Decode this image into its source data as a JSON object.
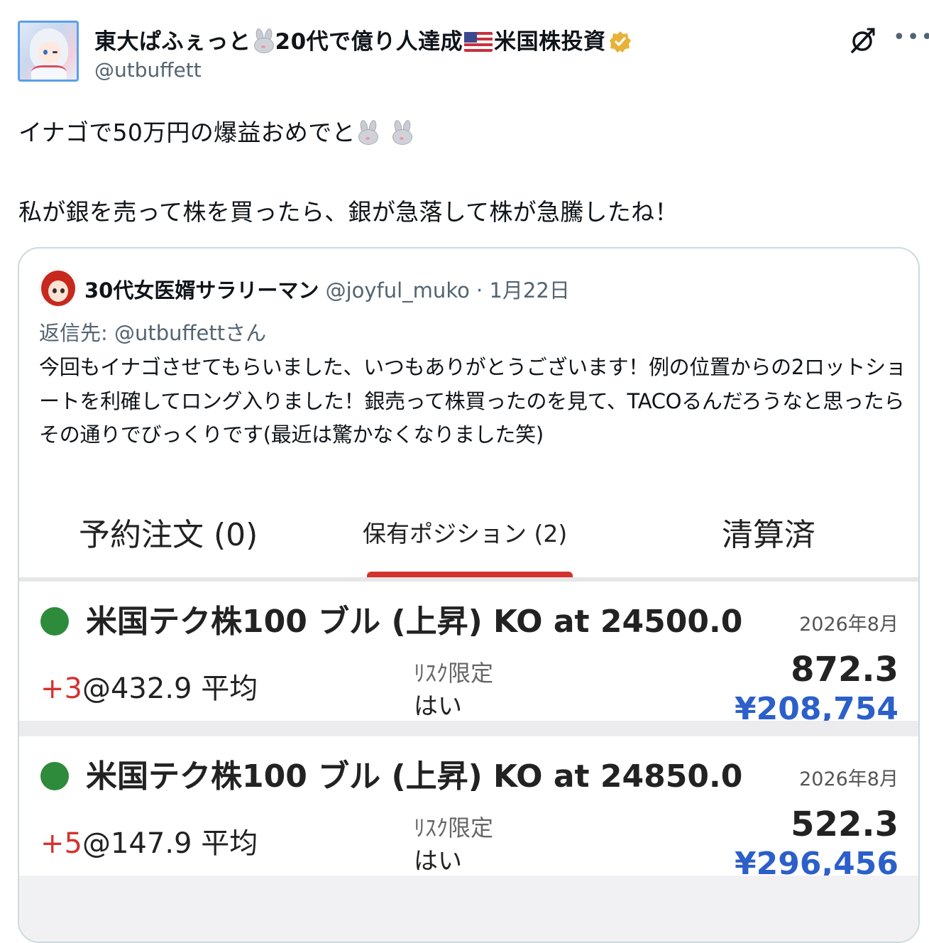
{
  "author": {
    "name_part1": "東大ぱふぇっと",
    "name_part2": "20代で億り人達成",
    "name_part3": "米国株投資",
    "handle": "@utbuffett"
  },
  "tweet": {
    "line1": "イナゴで50万円の爆益おめでと",
    "line2": "私が銀を売って株を買ったら、銀が急落して株が急騰したね！"
  },
  "quote": {
    "name": "30代女医婿サラリーマン",
    "handle": "@joyful_muko",
    "date": " · 1月22日",
    "reply_to": "返信先: @utbuffettさん",
    "body": "今回もイナゴさせてもらいました、いつもありがとうございます！例の位置からの2ロットショートを利確してロング入りました！銀売って株買ったのを見て、TACOるんだろうなと思ったらその通りでびっくりです(最近は驚かなくなりました笑)"
  },
  "screenshot": {
    "tabs": [
      "予約注文 (0)",
      "保有ポジション (2)",
      "清算済"
    ],
    "active_tab": 1,
    "positions": [
      {
        "title": "米国テク株100 ブル (上昇) KO at 24500.0",
        "date": "2026年8月",
        "qty": "+3",
        "avg": "@432.9 平均",
        "risk_label": "ﾘｽｸ限定",
        "risk_value": "はい",
        "price": "872.3",
        "value": "¥208,754"
      },
      {
        "title": "米国テク株100 ブル (上昇) KO at 24850.0",
        "date": "2026年8月",
        "qty": "+5",
        "avg": "@147.9 平均",
        "risk_label": "ﾘｽｸ限定",
        "risk_value": "はい",
        "price": "522.3",
        "value": "¥296,456"
      }
    ]
  },
  "colors": {
    "link_blue": "#2c5fc9",
    "accent_red": "#d2332f",
    "status_green": "#2e8b3c",
    "muted_text": "#536471"
  }
}
